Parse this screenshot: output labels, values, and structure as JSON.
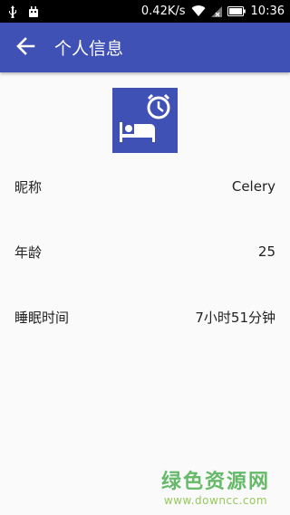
{
  "status_bar": {
    "network_speed": "0.42K/s",
    "time": "10:36",
    "icons": [
      "usb-icon",
      "android-debug-icon",
      "wifi-icon",
      "no-signal-icon",
      "battery-icon"
    ]
  },
  "app_bar": {
    "title": "个人信息",
    "back_icon": "arrow-back-icon",
    "color": "#3f51b5"
  },
  "profile": {
    "avatar_icon": "sleep-alarm-icon",
    "fields": [
      {
        "label": "昵称",
        "value": "Celery"
      },
      {
        "label": "年龄",
        "value": "25"
      },
      {
        "label": "睡眠时间",
        "value": "7小时51分钟"
      }
    ]
  },
  "watermark": {
    "main": "绿色资源网",
    "sub": "www.downcc.com"
  }
}
